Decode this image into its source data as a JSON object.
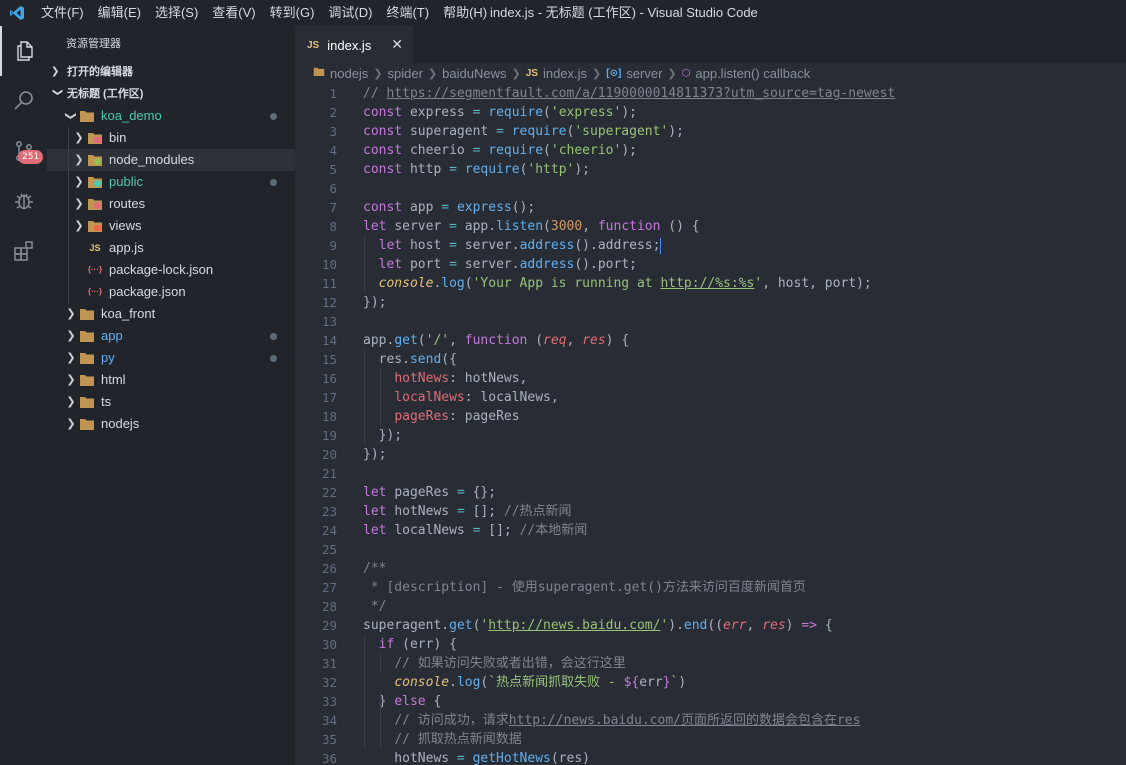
{
  "window": {
    "title": "index.js - 无标题 (工作区) - Visual Studio Code",
    "menu": [
      "文件(F)",
      "编辑(E)",
      "选择(S)",
      "查看(V)",
      "转到(G)",
      "调试(D)",
      "终端(T)",
      "帮助(H)"
    ]
  },
  "activity": {
    "scm_badge": "251",
    "icons": [
      "files-icon",
      "search-icon",
      "source-control-icon",
      "debug-icon",
      "extensions-icon"
    ]
  },
  "sidebar": {
    "title": "资源管理器",
    "open_editors": "打开的编辑器",
    "workspace": "无标题 (工作区)",
    "tree": [
      {
        "label": "koa_demo",
        "depth": 1,
        "expanded": true,
        "kind": "folder",
        "color": "green",
        "dot": true
      },
      {
        "label": "bin",
        "depth": 2,
        "expanded": false,
        "kind": "folder-bin"
      },
      {
        "label": "node_modules",
        "depth": 2,
        "expanded": false,
        "kind": "folder-node",
        "selected": true
      },
      {
        "label": "public",
        "depth": 2,
        "expanded": false,
        "kind": "folder-public",
        "color": "green",
        "dot": true
      },
      {
        "label": "routes",
        "depth": 2,
        "expanded": false,
        "kind": "folder-routes"
      },
      {
        "label": "views",
        "depth": 2,
        "expanded": false,
        "kind": "folder-views"
      },
      {
        "label": "app.js",
        "depth": 2,
        "kind": "file-js"
      },
      {
        "label": "package-lock.json",
        "depth": 2,
        "kind": "file-json"
      },
      {
        "label": "package.json",
        "depth": 2,
        "kind": "file-json"
      },
      {
        "label": "koa_front",
        "depth": 1,
        "expanded": false,
        "kind": "folder"
      },
      {
        "label": "app",
        "depth": 1,
        "expanded": false,
        "kind": "folder",
        "color": "blue",
        "dot": true
      },
      {
        "label": "py",
        "depth": 1,
        "expanded": false,
        "kind": "folder",
        "color": "blue",
        "dot": true
      },
      {
        "label": "html",
        "depth": 1,
        "expanded": false,
        "kind": "folder"
      },
      {
        "label": "ts",
        "depth": 1,
        "expanded": false,
        "kind": "folder"
      },
      {
        "label": "nodejs",
        "depth": 1,
        "expanded": false,
        "kind": "folder"
      }
    ]
  },
  "tab": {
    "icon": "JS",
    "label": "index.js"
  },
  "breadcrumb": [
    "nodejs",
    "spider",
    "baiduNews",
    "index.js",
    "server",
    "app.listen() callback"
  ],
  "editor": {
    "lines": [
      [
        [
          "t-cmt",
          "// "
        ],
        [
          "t-url",
          "https://segmentfault.com/a/1190000014811373?utm_source=tag-newest"
        ]
      ],
      [
        [
          "t-kw",
          "const "
        ],
        [
          "t-plain",
          "express "
        ],
        [
          "t-op",
          "= "
        ],
        [
          "t-fn",
          "require"
        ],
        [
          "t-plain",
          "("
        ],
        [
          "t-str",
          "'express'"
        ],
        [
          "t-plain",
          ");"
        ]
      ],
      [
        [
          "t-kw",
          "const "
        ],
        [
          "t-plain",
          "superagent "
        ],
        [
          "t-op",
          "= "
        ],
        [
          "t-fn",
          "require"
        ],
        [
          "t-plain",
          "("
        ],
        [
          "t-str",
          "'superagent'"
        ],
        [
          "t-plain",
          ");"
        ]
      ],
      [
        [
          "t-kw",
          "const "
        ],
        [
          "t-plain",
          "cheerio "
        ],
        [
          "t-op",
          "= "
        ],
        [
          "t-fn",
          "require"
        ],
        [
          "t-plain",
          "("
        ],
        [
          "t-str",
          "'cheerio'"
        ],
        [
          "t-plain",
          ");"
        ]
      ],
      [
        [
          "t-kw",
          "const "
        ],
        [
          "t-plain",
          "http "
        ],
        [
          "t-op",
          "= "
        ],
        [
          "t-fn",
          "require"
        ],
        [
          "t-plain",
          "("
        ],
        [
          "t-str",
          "'http'"
        ],
        [
          "t-plain",
          ");"
        ]
      ],
      [],
      [
        [
          "t-kw",
          "const "
        ],
        [
          "t-plain",
          "app "
        ],
        [
          "t-op",
          "= "
        ],
        [
          "t-fn",
          "express"
        ],
        [
          "t-plain",
          "();"
        ]
      ],
      [
        [
          "t-kw",
          "let "
        ],
        [
          "t-plain",
          "server "
        ],
        [
          "t-op",
          "= "
        ],
        [
          "t-plain",
          "app."
        ],
        [
          "t-fn",
          "listen"
        ],
        [
          "t-plain",
          "("
        ],
        [
          "t-num",
          "3000"
        ],
        [
          "t-plain",
          ", "
        ],
        [
          "t-kw",
          "function "
        ],
        [
          "t-plain",
          "() {"
        ]
      ],
      [
        [
          "t-plain",
          "  "
        ],
        [
          "t-kw",
          "let "
        ],
        [
          "t-plain",
          "host "
        ],
        [
          "t-op",
          "= "
        ],
        [
          "t-plain",
          "server."
        ],
        [
          "t-fn",
          "address"
        ],
        [
          "t-plain",
          "().address;"
        ]
      ],
      [
        [
          "t-plain",
          "  "
        ],
        [
          "t-kw",
          "let "
        ],
        [
          "t-plain",
          "port "
        ],
        [
          "t-op",
          "= "
        ],
        [
          "t-plain",
          "server."
        ],
        [
          "t-fn",
          "address"
        ],
        [
          "t-plain",
          "().port;"
        ]
      ],
      [
        [
          "t-plain",
          "  "
        ],
        [
          "t-ital",
          "console"
        ],
        [
          "t-plain",
          "."
        ],
        [
          "t-fn",
          "log"
        ],
        [
          "t-plain",
          "("
        ],
        [
          "t-str",
          "'Your App is running at "
        ],
        [
          "t-strurl",
          "http://%s:%s"
        ],
        [
          "t-str",
          "'"
        ],
        [
          "t-plain",
          ", host, port);"
        ]
      ],
      [
        [
          "t-plain",
          "});"
        ]
      ],
      [],
      [
        [
          "t-plain",
          "app."
        ],
        [
          "t-fn",
          "get"
        ],
        [
          "t-plain",
          "("
        ],
        [
          "t-str",
          "'/'"
        ],
        [
          "t-plain",
          ", "
        ],
        [
          "t-kw",
          "function "
        ],
        [
          "t-plain",
          "("
        ],
        [
          "t-par",
          "req"
        ],
        [
          "t-plain",
          ", "
        ],
        [
          "t-par",
          "res"
        ],
        [
          "t-plain",
          ") {"
        ]
      ],
      [
        [
          "t-plain",
          "  res."
        ],
        [
          "t-fn",
          "send"
        ],
        [
          "t-plain",
          "({"
        ]
      ],
      [
        [
          "t-plain",
          "    "
        ],
        [
          "t-prop",
          "hotNews"
        ],
        [
          "t-plain",
          ": hotNews,"
        ]
      ],
      [
        [
          "t-plain",
          "    "
        ],
        [
          "t-prop",
          "localNews"
        ],
        [
          "t-plain",
          ": localNews,"
        ]
      ],
      [
        [
          "t-plain",
          "    "
        ],
        [
          "t-prop",
          "pageRes"
        ],
        [
          "t-plain",
          ": pageRes"
        ]
      ],
      [
        [
          "t-plain",
          "  });"
        ]
      ],
      [
        [
          "t-plain",
          "});"
        ]
      ],
      [],
      [
        [
          "t-kw",
          "let "
        ],
        [
          "t-plain",
          "pageRes "
        ],
        [
          "t-op",
          "= "
        ],
        [
          "t-plain",
          "{};"
        ]
      ],
      [
        [
          "t-kw",
          "let "
        ],
        [
          "t-plain",
          "hotNews "
        ],
        [
          "t-op",
          "= "
        ],
        [
          "t-plain",
          "[]; "
        ],
        [
          "t-cmt",
          "//热点新闻"
        ]
      ],
      [
        [
          "t-kw",
          "let "
        ],
        [
          "t-plain",
          "localNews "
        ],
        [
          "t-op",
          "= "
        ],
        [
          "t-plain",
          "[]; "
        ],
        [
          "t-cmt",
          "//本地新闻"
        ]
      ],
      [],
      [
        [
          "t-cmt",
          "/**"
        ]
      ],
      [
        [
          "t-cmt",
          " * [description] - 使用superagent.get()方法来访问百度新闻首页"
        ]
      ],
      [
        [
          "t-cmt",
          " */"
        ]
      ],
      [
        [
          "t-plain",
          "superagent."
        ],
        [
          "t-fn",
          "get"
        ],
        [
          "t-plain",
          "("
        ],
        [
          "t-str",
          "'"
        ],
        [
          "t-strurl",
          "http://news.baidu.com/"
        ],
        [
          "t-str",
          "'"
        ],
        [
          "t-plain",
          ")."
        ],
        [
          "t-fn",
          "end"
        ],
        [
          "t-plain",
          "(("
        ],
        [
          "t-par",
          "err"
        ],
        [
          "t-plain",
          ", "
        ],
        [
          "t-par",
          "res"
        ],
        [
          "t-plain",
          ") "
        ],
        [
          "t-kw",
          "=> "
        ],
        [
          "t-plain",
          "{"
        ]
      ],
      [
        [
          "t-plain",
          "  "
        ],
        [
          "t-kw",
          "if "
        ],
        [
          "t-plain",
          "(err) {"
        ]
      ],
      [
        [
          "t-plain",
          "    "
        ],
        [
          "t-cmt",
          "// 如果访问失败或者出错，会这行这里"
        ]
      ],
      [
        [
          "t-plain",
          "    "
        ],
        [
          "t-ital",
          "console"
        ],
        [
          "t-plain",
          "."
        ],
        [
          "t-fn",
          "log"
        ],
        [
          "t-plain",
          "("
        ],
        [
          "t-tpl",
          "`热点新闻抓取失败 - "
        ],
        [
          "t-kw",
          "${"
        ],
        [
          "t-plain",
          "err"
        ],
        [
          "t-kw",
          "}"
        ],
        [
          "t-tpl",
          "`"
        ],
        [
          "t-plain",
          ")"
        ]
      ],
      [
        [
          "t-plain",
          "  } "
        ],
        [
          "t-kw",
          "else "
        ],
        [
          "t-plain",
          "{"
        ]
      ],
      [
        [
          "t-plain",
          "    "
        ],
        [
          "t-cmt",
          "// 访问成功，请求"
        ],
        [
          "t-url",
          "http://news.baidu.com/页面所返回的数据会包含在res"
        ]
      ],
      [
        [
          "t-plain",
          "    "
        ],
        [
          "t-cmt",
          "// 抓取热点新闻数据"
        ]
      ],
      [
        [
          "t-plain",
          "    hotNews "
        ],
        [
          "t-op",
          "= "
        ],
        [
          "t-fn",
          "getHotNews"
        ],
        [
          "t-plain",
          "(res)"
        ]
      ]
    ]
  }
}
